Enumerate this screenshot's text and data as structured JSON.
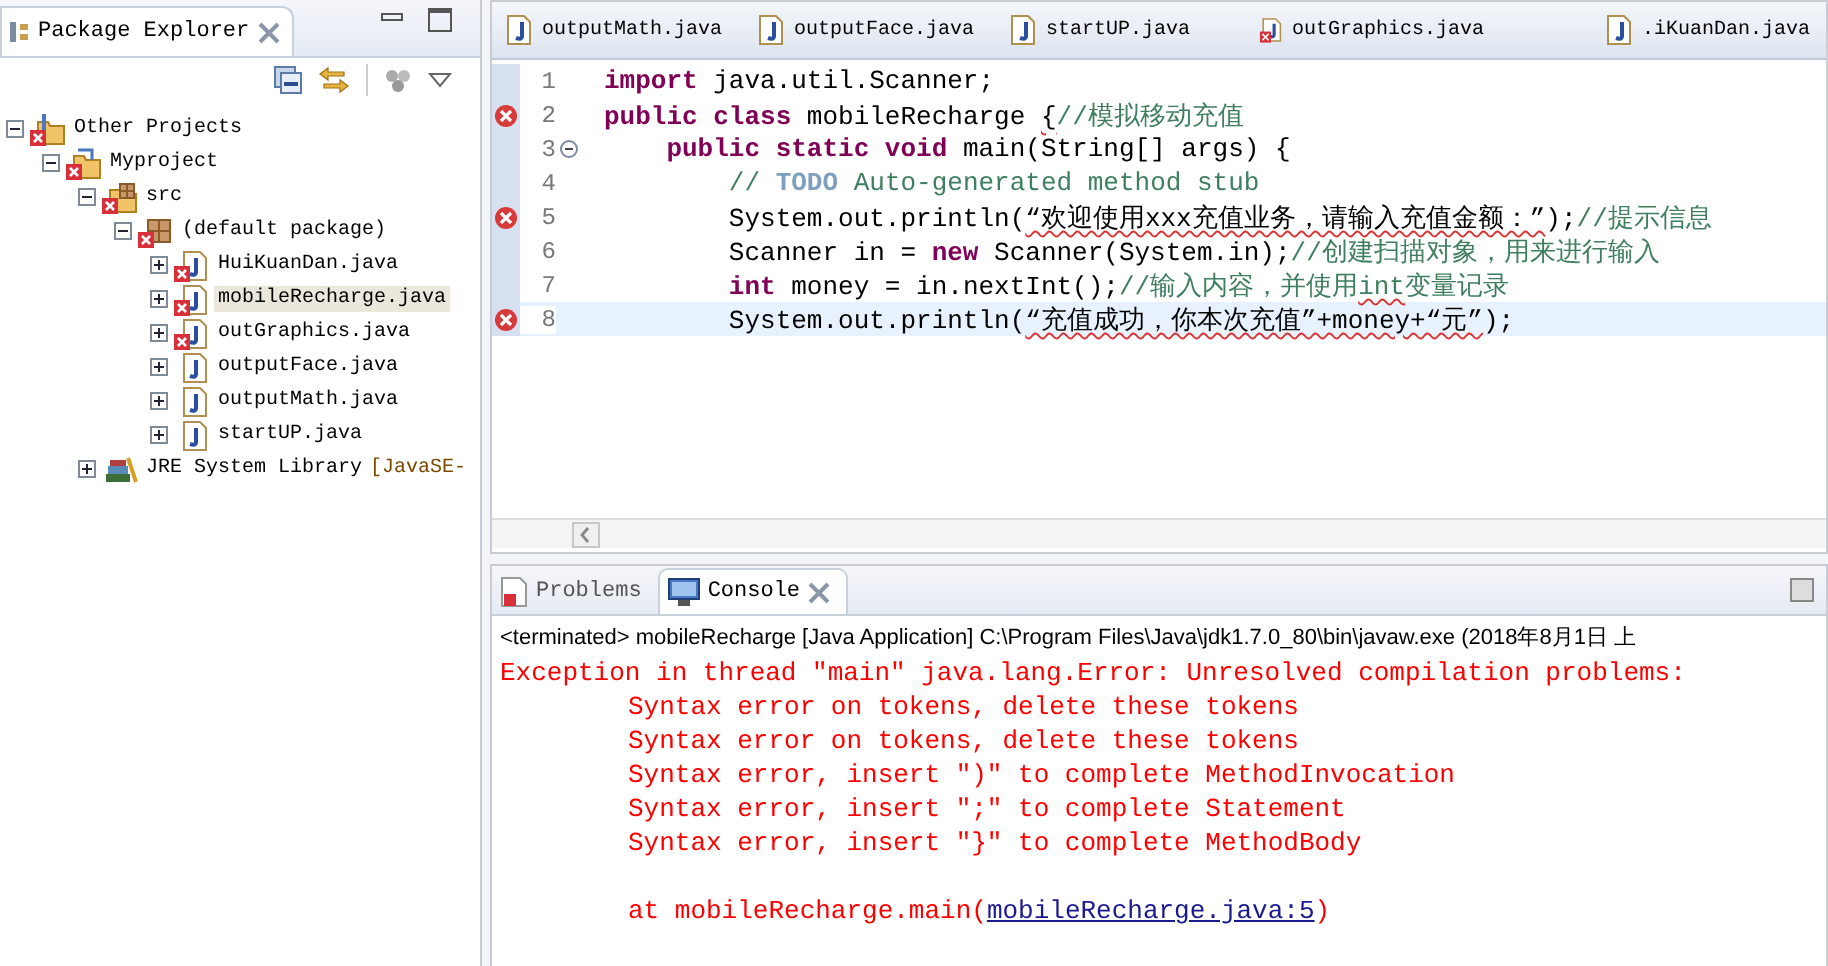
{
  "package_explorer": {
    "title": "Package Explorer",
    "tree": [
      {
        "label": "Other Projects",
        "kind": "workingset",
        "error": true,
        "expanded": true,
        "selected": false,
        "children": [
          {
            "label": "Myproject",
            "kind": "project",
            "error": true,
            "expanded": true,
            "selected": false,
            "children": [
              {
                "label": "src",
                "kind": "srcfolder",
                "error": true,
                "expanded": true,
                "selected": false,
                "children": [
                  {
                    "label": "(default package)",
                    "kind": "package",
                    "error": true,
                    "expanded": true,
                    "selected": false,
                    "children": [
                      {
                        "label": "HuiKuanDan.java",
                        "kind": "java",
                        "error": true,
                        "expanded": false,
                        "selected": false
                      },
                      {
                        "label": "mobileRecharge.java",
                        "kind": "java",
                        "error": true,
                        "expanded": false,
                        "selected": true
                      },
                      {
                        "label": "outGraphics.java",
                        "kind": "java",
                        "error": true,
                        "expanded": false,
                        "selected": false
                      },
                      {
                        "label": "outputFace.java",
                        "kind": "java",
                        "error": false,
                        "expanded": false,
                        "selected": false
                      },
                      {
                        "label": "outputMath.java",
                        "kind": "java",
                        "error": false,
                        "expanded": false,
                        "selected": false
                      },
                      {
                        "label": "startUP.java",
                        "kind": "java",
                        "error": false,
                        "expanded": false,
                        "selected": false
                      }
                    ]
                  }
                ]
              },
              {
                "label": "JRE System Library",
                "decoration": "[JavaSE-",
                "kind": "library",
                "error": false,
                "expanded": false,
                "selected": false
              }
            ]
          }
        ]
      }
    ]
  },
  "editor": {
    "tabs": [
      {
        "label": "outputMath.java",
        "error": false
      },
      {
        "label": "outputFace.java",
        "error": false
      },
      {
        "label": "startUP.java",
        "error": false
      },
      {
        "label": "outGraphics.java",
        "error": true
      },
      {
        "label": ".iKuanDan.java",
        "error": false
      }
    ],
    "lines": [
      {
        "number": "1",
        "error": false,
        "fold": false,
        "highlighted": false,
        "segments": [
          {
            "kind": "keyword",
            "text": "import",
            "squiggle": false
          },
          {
            "kind": "plain",
            "text": " java.util.Scanner;",
            "squiggle": false
          }
        ]
      },
      {
        "number": "2",
        "error": true,
        "fold": false,
        "highlighted": false,
        "segments": [
          {
            "kind": "keyword",
            "text": "public class",
            "squiggle": false
          },
          {
            "kind": "plain",
            "text": " mobileRecharge ",
            "squiggle": false
          },
          {
            "kind": "plain",
            "text": "{",
            "squiggle": true
          },
          {
            "kind": "comment",
            "text": "//模拟移动充值",
            "squiggle": false
          }
        ]
      },
      {
        "number": "3",
        "error": false,
        "fold": true,
        "highlighted": false,
        "segments": [
          {
            "kind": "keyword",
            "text": "    public static void",
            "squiggle": false
          },
          {
            "kind": "plain",
            "text": " main(String[] args) {",
            "squiggle": false
          }
        ]
      },
      {
        "number": "4",
        "error": false,
        "fold": false,
        "highlighted": false,
        "segments": [
          {
            "kind": "comment",
            "text": "        // ",
            "squiggle": false
          },
          {
            "kind": "todo",
            "text": "TODO",
            "squiggle": false
          },
          {
            "kind": "comment",
            "text": " Auto-generated method stub",
            "squiggle": false
          }
        ]
      },
      {
        "number": "5",
        "error": true,
        "fold": false,
        "highlighted": false,
        "segments": [
          {
            "kind": "plain",
            "text": "        System.out.println(",
            "squiggle": false
          },
          {
            "kind": "plain",
            "text": "“欢迎使用xxx充值业务，请输入充值金额：”",
            "squiggle": true
          },
          {
            "kind": "plain",
            "text": ");",
            "squiggle": false
          },
          {
            "kind": "comment",
            "text": "//提示信息",
            "squiggle": false
          }
        ]
      },
      {
        "number": "6",
        "error": false,
        "fold": false,
        "highlighted": false,
        "segments": [
          {
            "kind": "plain",
            "text": "        Scanner in = ",
            "squiggle": false
          },
          {
            "kind": "keyword",
            "text": "new",
            "squiggle": false
          },
          {
            "kind": "plain",
            "text": " Scanner(System.in);",
            "squiggle": false
          },
          {
            "kind": "comment",
            "text": "//创建扫描对象，用来进行输入",
            "squiggle": false
          }
        ]
      },
      {
        "number": "7",
        "error": false,
        "fold": false,
        "highlighted": false,
        "segments": [
          {
            "kind": "keyword",
            "text": "        int",
            "squiggle": false
          },
          {
            "kind": "plain",
            "text": " money = in.nextInt();",
            "squiggle": false
          },
          {
            "kind": "comment",
            "text": "//输入内容，并使用",
            "squiggle": false
          },
          {
            "kind": "comment",
            "text": "int",
            "squiggle": true
          },
          {
            "kind": "comment",
            "text": "变量记录",
            "squiggle": false
          }
        ]
      },
      {
        "number": "8",
        "error": true,
        "fold": false,
        "highlighted": true,
        "segments": [
          {
            "kind": "plain",
            "text": "        System.out.println(",
            "squiggle": false
          },
          {
            "kind": "plain",
            "text": "“充值成功，你本次充值”+money+“元”",
            "squiggle": true
          },
          {
            "kind": "plain",
            "text": ");",
            "squiggle": false
          }
        ]
      }
    ]
  },
  "bottom": {
    "tabs": [
      {
        "label": "Problems",
        "selected": false
      },
      {
        "label": "Console",
        "selected": true
      }
    ],
    "console": [
      {
        "kind": "header",
        "text": "<terminated> mobileRecharge [Java Application] C:\\Program Files\\Java\\jdk1.7.0_80\\bin\\javaw.exe (2018年8月1日 上"
      },
      {
        "kind": "error",
        "text": "Exception in thread \"main\" java.lang.Error: Unresolved compilation problems:"
      },
      {
        "kind": "detail",
        "text": "Syntax error on tokens, delete these tokens"
      },
      {
        "kind": "detail",
        "text": "Syntax error on tokens, delete these tokens"
      },
      {
        "kind": "detail",
        "text": "Syntax error, insert \")\" to complete MethodInvocation"
      },
      {
        "kind": "detail",
        "text": "Syntax error, insert \";\" to complete Statement"
      },
      {
        "kind": "detail",
        "text": "Syntax error, insert \"}\" to complete MethodBody"
      },
      {
        "kind": "trace",
        "text": "at mobileRecharge.main(",
        "link": "mobileRecharge.java:5",
        "after": ")"
      }
    ]
  }
}
